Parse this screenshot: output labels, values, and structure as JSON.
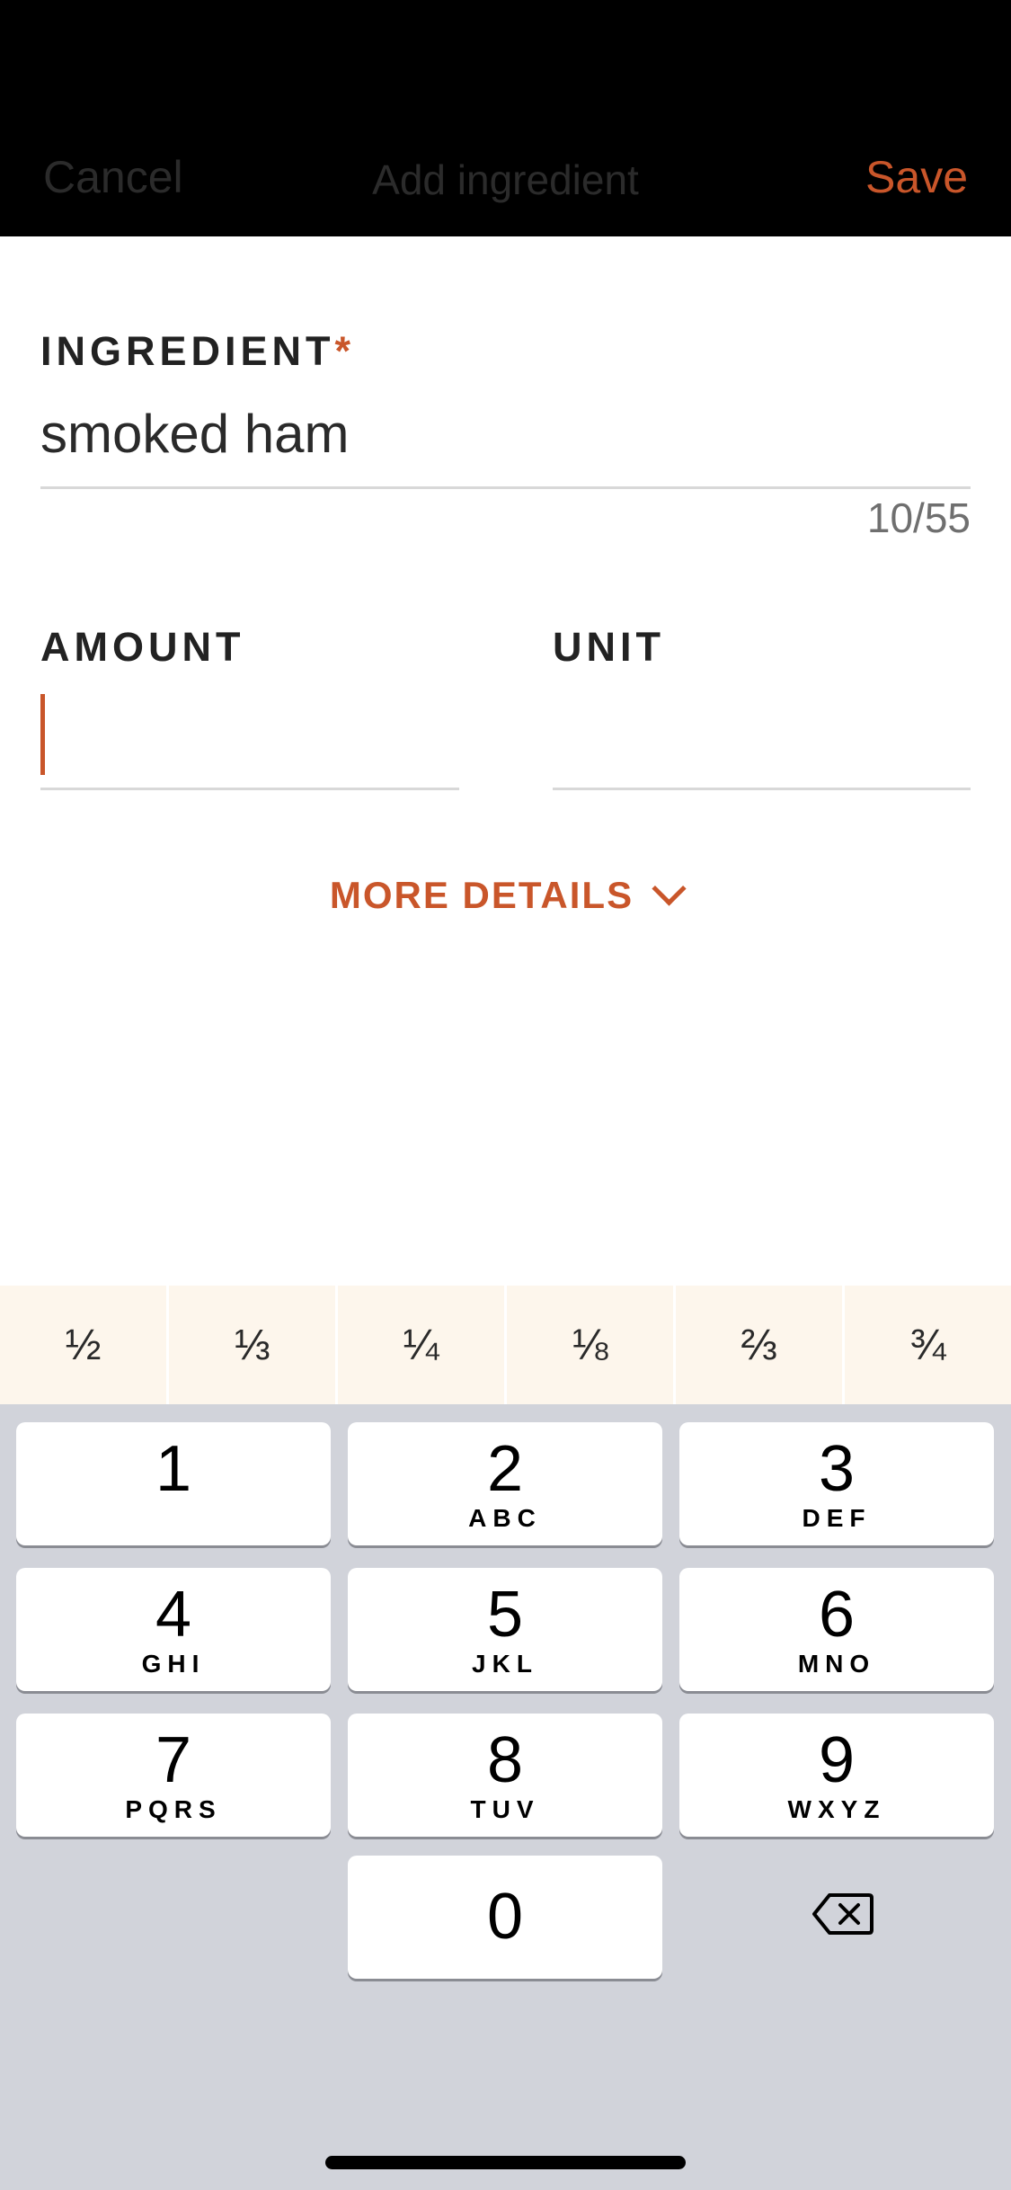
{
  "header": {
    "cancel_label": "Cancel",
    "title": "Add ingredient",
    "save_label": "Save"
  },
  "form": {
    "ingredient": {
      "label": "INGREDIENT",
      "required_mark": "*",
      "value": "smoked ham",
      "counter": "10/55"
    },
    "amount": {
      "label": "AMOUNT",
      "value": ""
    },
    "unit": {
      "label": "UNIT",
      "value": ""
    },
    "more_details_label": "MORE DETAILS"
  },
  "fractions": [
    "½",
    "⅓",
    "¼",
    "⅛",
    "⅔",
    "¾"
  ],
  "keypad": {
    "keys": [
      {
        "digit": "1",
        "letters": ""
      },
      {
        "digit": "2",
        "letters": "ABC"
      },
      {
        "digit": "3",
        "letters": "DEF"
      },
      {
        "digit": "4",
        "letters": "GHI"
      },
      {
        "digit": "5",
        "letters": "JKL"
      },
      {
        "digit": "6",
        "letters": "MNO"
      },
      {
        "digit": "7",
        "letters": "PQRS"
      },
      {
        "digit": "8",
        "letters": "TUV"
      },
      {
        "digit": "9",
        "letters": "WXYZ"
      },
      {
        "digit": "0",
        "letters": ""
      }
    ]
  },
  "colors": {
    "accent": "#c9562a",
    "header_bg": "#000000",
    "fraction_bar_bg": "#fdf6ec",
    "keypad_bg": "#d1d3da"
  },
  "icons": {
    "more_details": "chevron-down-icon",
    "delete": "backspace-icon"
  }
}
